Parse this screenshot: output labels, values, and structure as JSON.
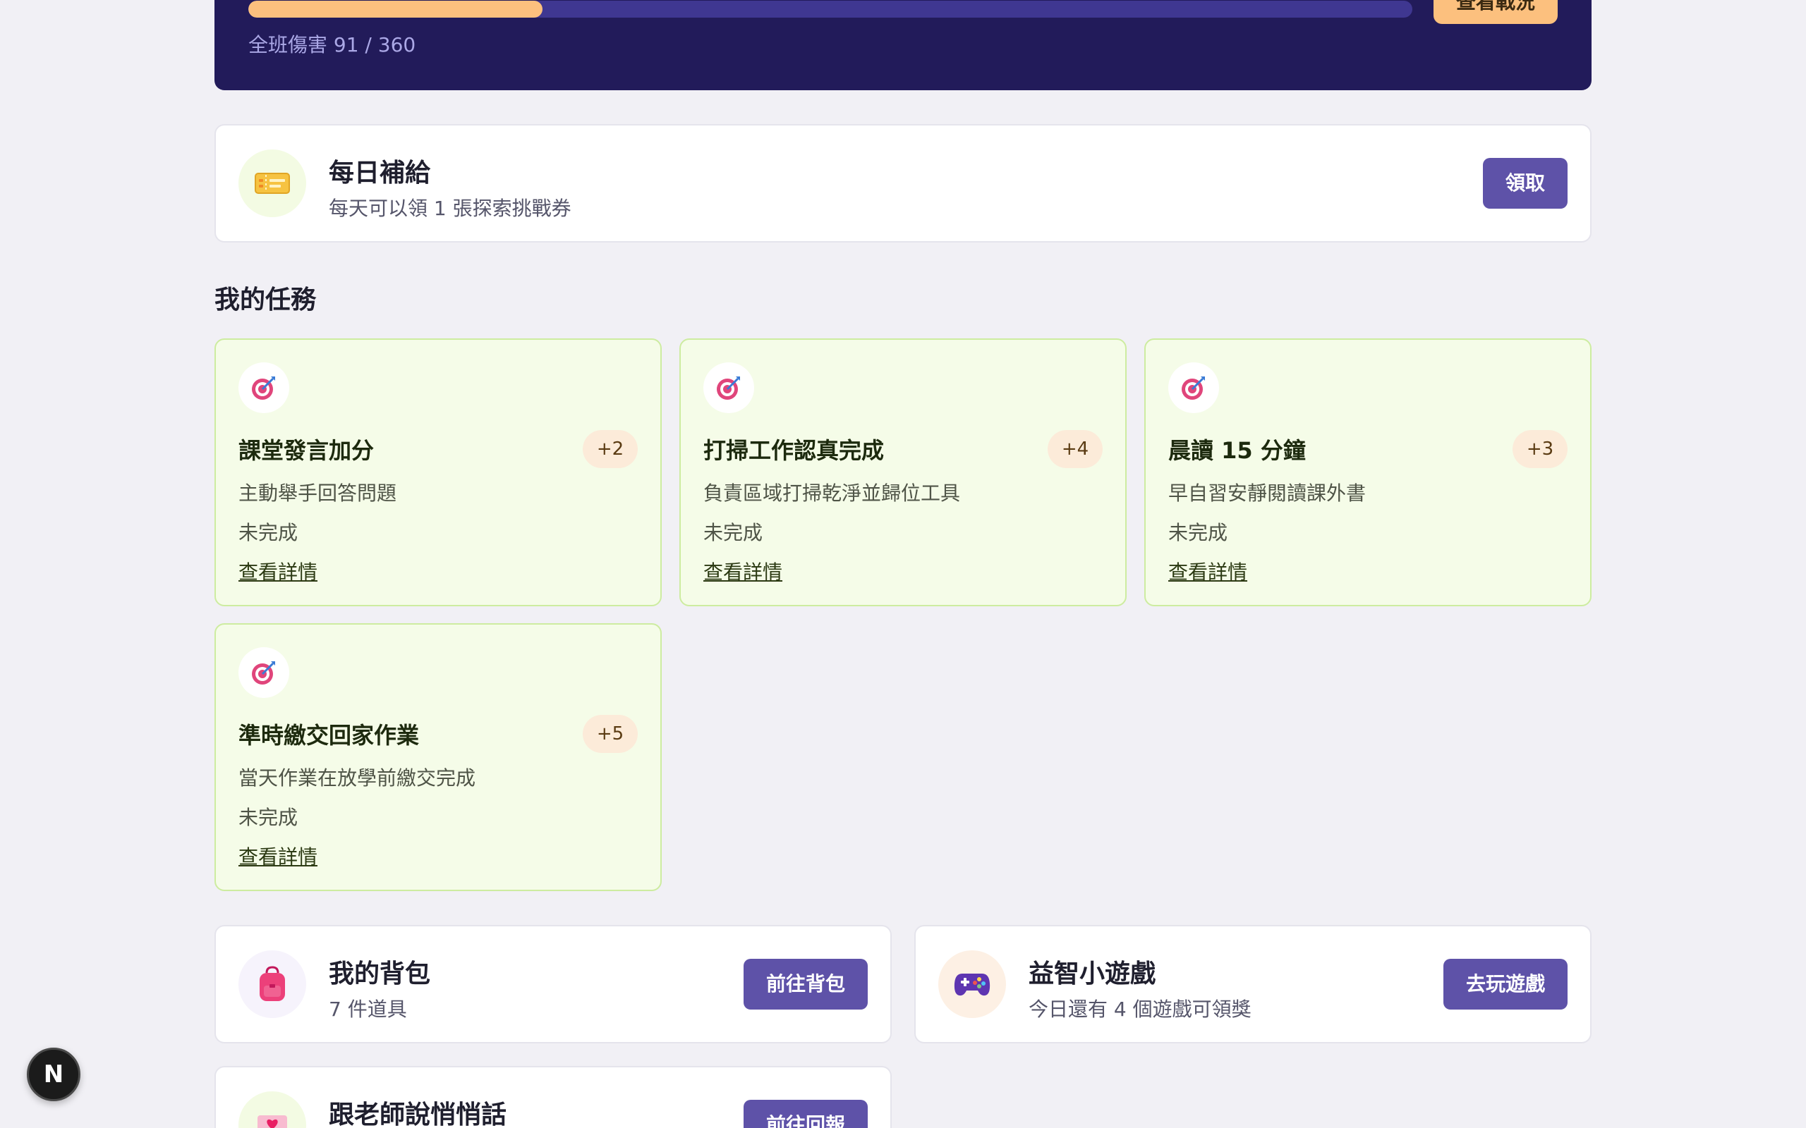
{
  "raid": {
    "damage_text": "全班傷害 91 / 360",
    "damage_current": 91,
    "damage_total": 360,
    "button_label": "查看戰況"
  },
  "daily": {
    "title": "每日補給",
    "subtitle": "每天可以領 1 張探索挑戰券",
    "button_label": "領取",
    "icon": "ticket-icon"
  },
  "missions_section": {
    "heading": "我的任務",
    "link_label": "查看詳情",
    "items": [
      {
        "title": "課堂發言加分",
        "points": "+2",
        "desc": "主動舉手回答問題",
        "status": "未完成"
      },
      {
        "title": "打掃工作認真完成",
        "points": "+4",
        "desc": "負責區域打掃乾淨並歸位工具",
        "status": "未完成"
      },
      {
        "title": "晨讀 15 分鐘",
        "points": "+3",
        "desc": "早自習安靜閱讀課外書",
        "status": "未完成"
      },
      {
        "title": "準時繳交回家作業",
        "points": "+5",
        "desc": "當天作業在放學前繳交完成",
        "status": "未完成"
      }
    ]
  },
  "backpack": {
    "title": "我的背包",
    "subtitle": "7 件道具",
    "button_label": "前往背包",
    "icon": "backpack-icon"
  },
  "games": {
    "title": "益智小遊戲",
    "subtitle": "今日還有 4 個遊戲可領獎",
    "button_label": "去玩遊戲",
    "icon": "gamepad-icon"
  },
  "whisper": {
    "title": "跟老師說悄悄話",
    "button_label": "前往回報",
    "icon": "love-letter-icon"
  },
  "dev_badge": {
    "label": "N"
  },
  "colors": {
    "primary": "#5e52a8",
    "raid_bg": "#221b5a",
    "raid_fill": "#fcc07e",
    "mission_bg": "#f5fce8",
    "mission_border": "#cdeca0"
  }
}
